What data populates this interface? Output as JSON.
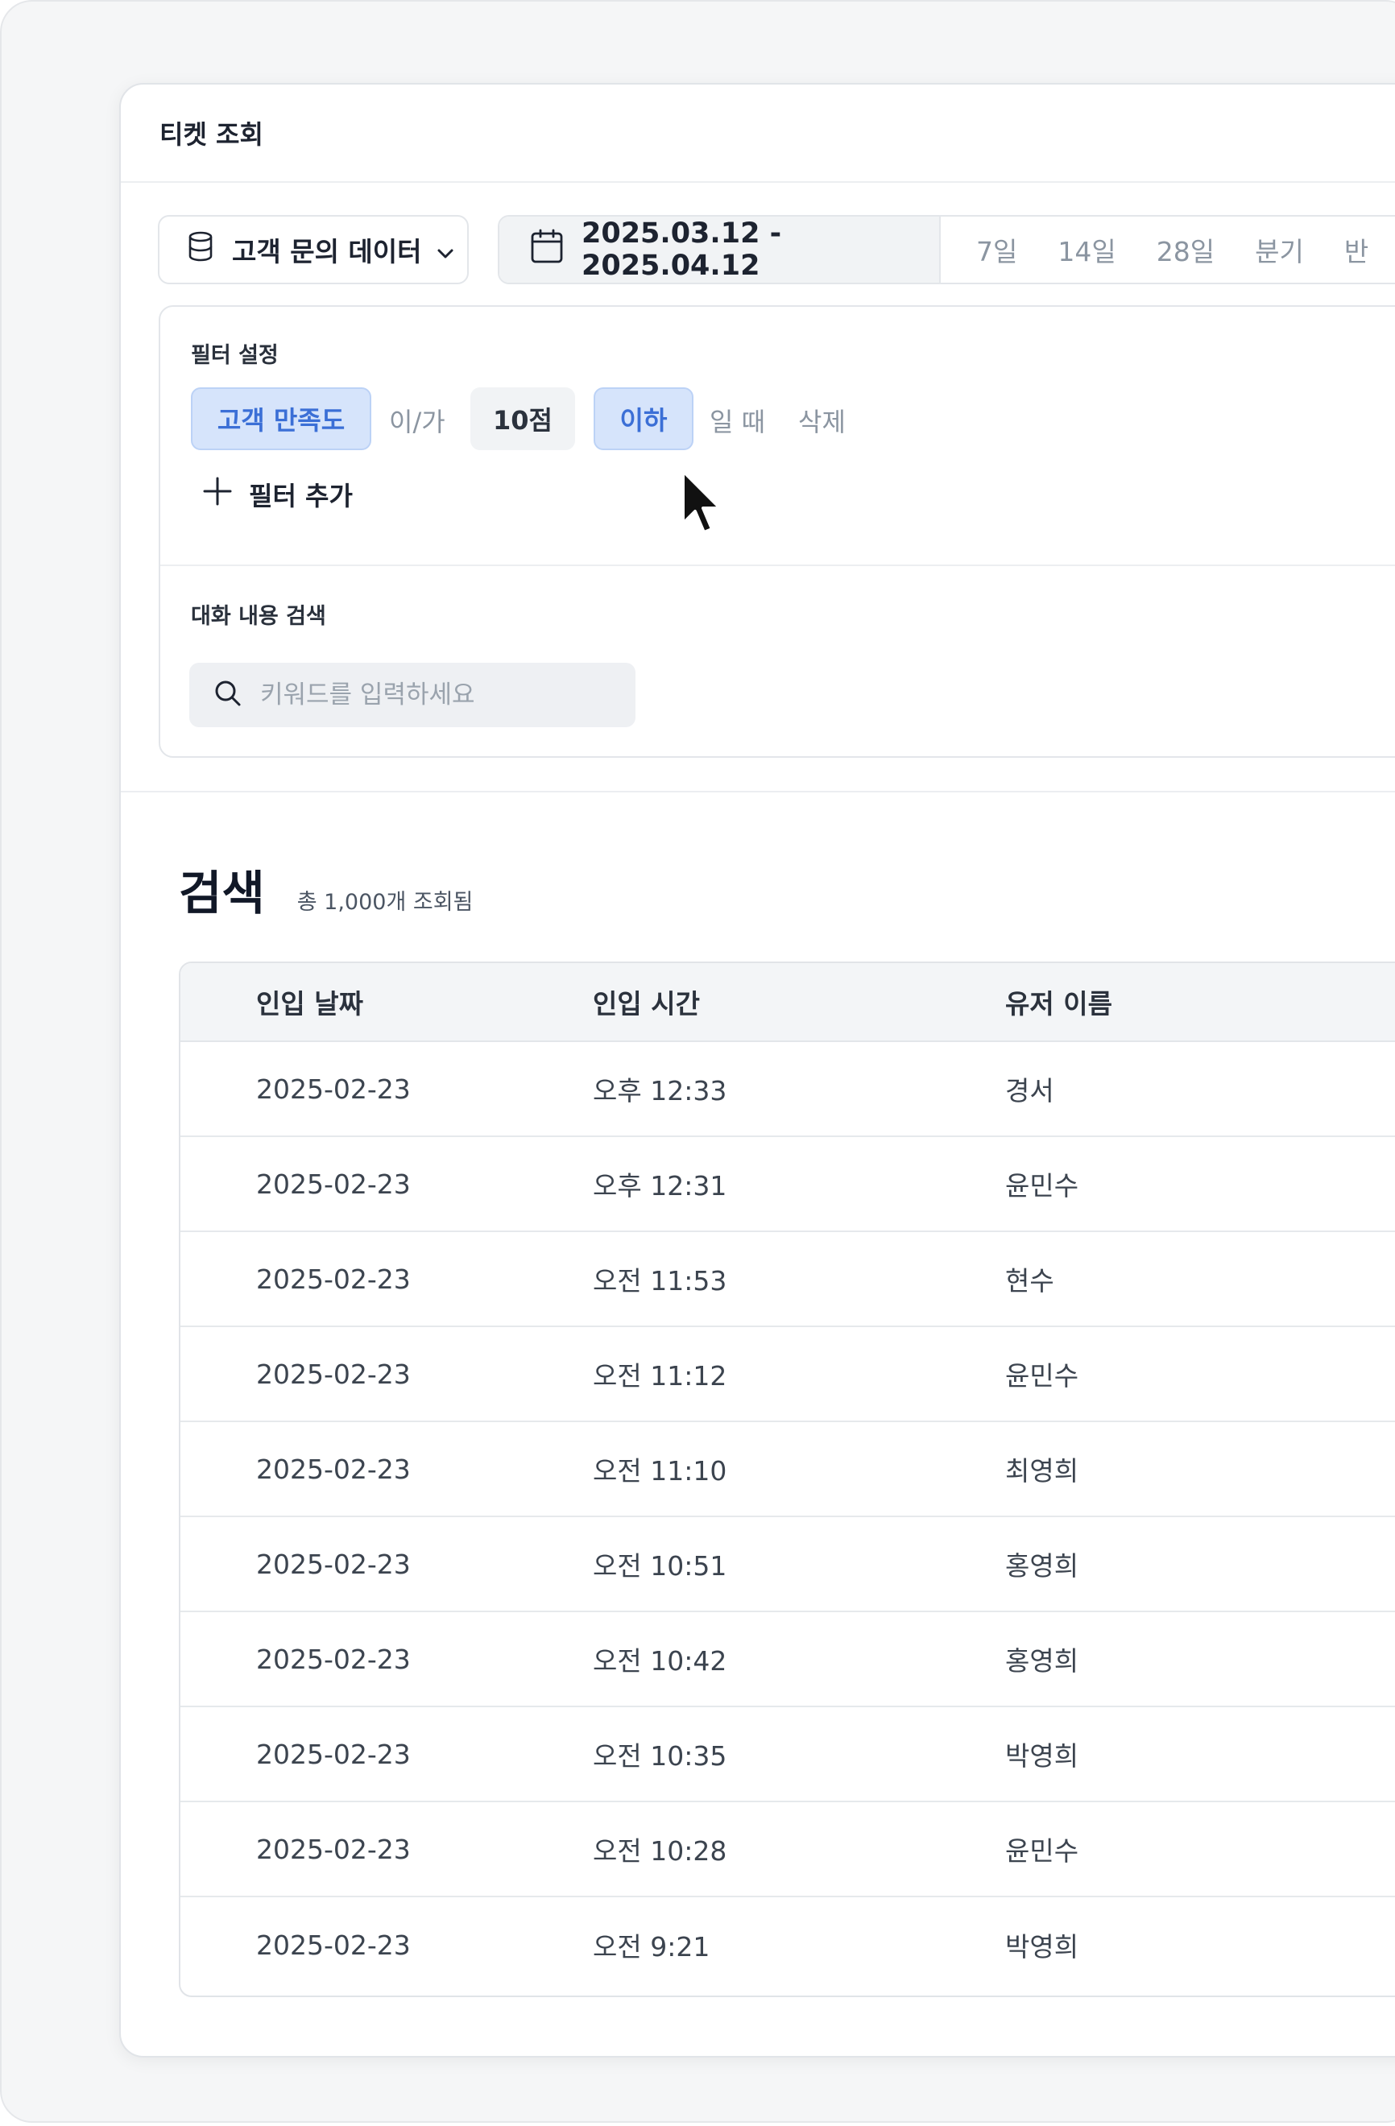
{
  "header": {
    "title": "티켓 조회"
  },
  "toolbar": {
    "source_label": "고객 문의 데이터",
    "date_range": "2025.03.12  - 2025.04.12",
    "presets": [
      "7일",
      "14일",
      "28일",
      "분기",
      "반"
    ]
  },
  "filters": {
    "section_label": "필터 설정",
    "field": "고객 만족도",
    "particle": "이/가",
    "value": "10점",
    "operator": "이하",
    "suffix": "일 때",
    "delete_label": "삭제",
    "add_label": "필터 추가"
  },
  "search": {
    "section_label": "대화 내용 검색",
    "placeholder": "키워드를 입력하세요"
  },
  "results": {
    "title": "검색",
    "count_text": "총 1,000개 조회됨"
  },
  "table": {
    "columns": [
      "인입 날짜",
      "인입 시간",
      "유저 이름"
    ],
    "rows": [
      [
        "2025-02-23",
        "오후 12:33",
        "경서"
      ],
      [
        "2025-02-23",
        "오후 12:31",
        "윤민수"
      ],
      [
        "2025-02-23",
        "오전 11:53",
        "현수"
      ],
      [
        "2025-02-23",
        "오전 11:12",
        "윤민수"
      ],
      [
        "2025-02-23",
        "오전 11:10",
        "최영희"
      ],
      [
        "2025-02-23",
        "오전 10:51",
        "홍영희"
      ],
      [
        "2025-02-23",
        "오전 10:42",
        "홍영희"
      ],
      [
        "2025-02-23",
        "오전 10:35",
        "박영희"
      ],
      [
        "2025-02-23",
        "오전 10:28",
        "윤민수"
      ],
      [
        "2025-02-23",
        "오전 9:21",
        "박영희"
      ]
    ]
  },
  "icons": {
    "database": "database-icon",
    "calendar": "calendar-icon",
    "chevron": "chevron-down-icon",
    "plus": "plus-icon",
    "search": "search-icon",
    "cursor": "mouse-cursor-icon"
  },
  "colors": {
    "accent_chip_bg": "#d6e4fb",
    "accent_text": "#3b6fd6",
    "muted_text": "#8b95a1"
  }
}
